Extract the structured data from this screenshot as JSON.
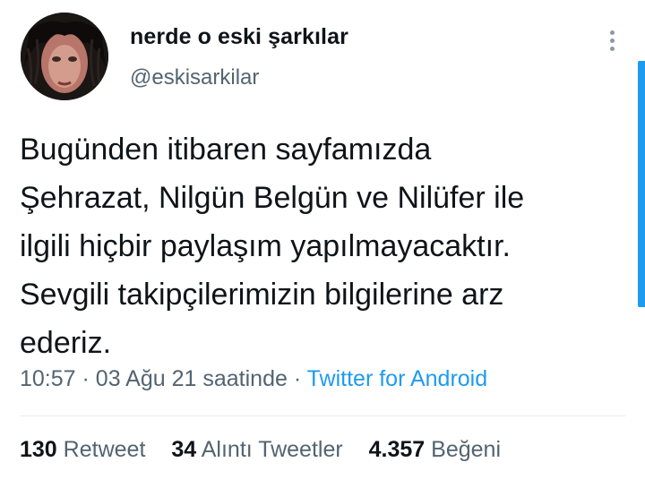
{
  "author": {
    "display_name": "nerde o eski şarkılar",
    "handle": "@eskisarkilar"
  },
  "tweet": {
    "lines": [
      "Bugünden itibaren sayfamızda",
      "Şehrazat, Nilgün Belgün ve Nilüfer ile",
      "ilgili hiçbir paylaşım yapılmayacaktır.",
      "Sevgili takipçilerimizin bilgilerine arz",
      "ederiz."
    ],
    "time": "10:57",
    "separator": "·",
    "date": "03 Ağu 21 saatinde",
    "source": "Twitter for Android"
  },
  "stats": {
    "retweets": {
      "count": "130",
      "label": "Retweet"
    },
    "quotes": {
      "count": "34",
      "label": "Alıntı Tweetler"
    },
    "likes": {
      "count": "4.357",
      "label": "Beğeni"
    }
  },
  "icons": {
    "more": "more-vertical-icon"
  },
  "colors": {
    "text": "#0f1419",
    "secondary": "#536471",
    "accent": "#1d9bf0"
  }
}
